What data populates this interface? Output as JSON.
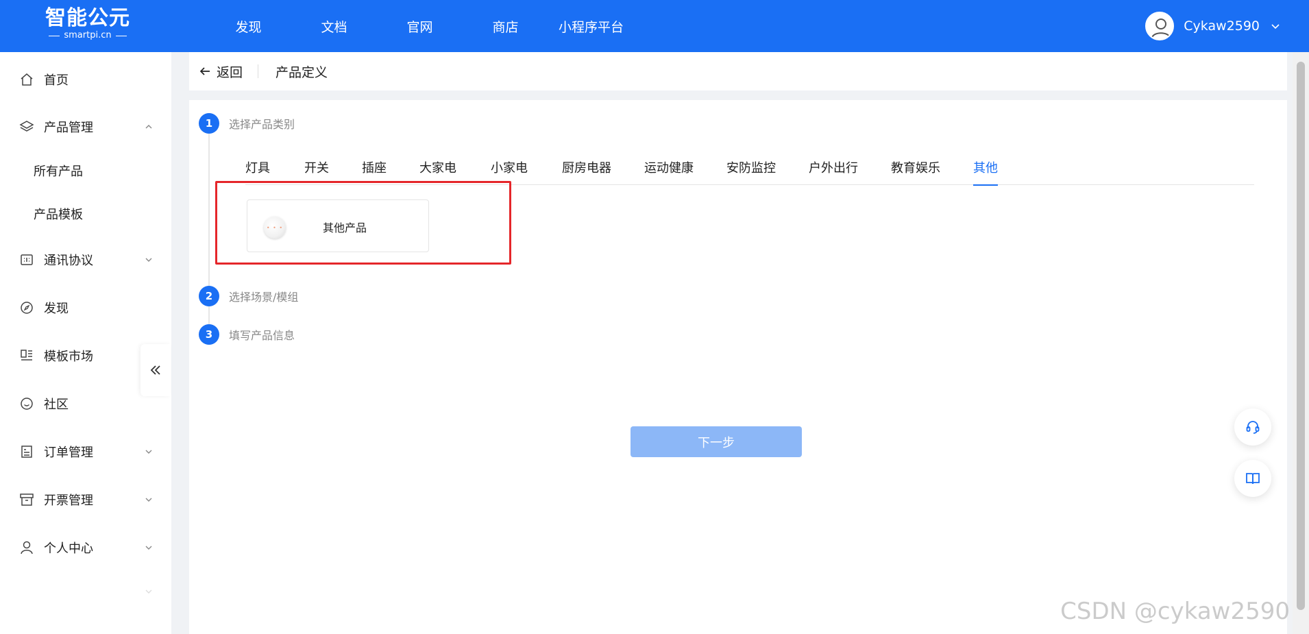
{
  "brand": {
    "name": "智能公元",
    "domain": "smartpi.cn"
  },
  "topnav": {
    "items": [
      "发现",
      "文档",
      "官网",
      "商店",
      "小程序平台"
    ]
  },
  "user": {
    "name": "Cykaw2590"
  },
  "sidebar": {
    "items": [
      {
        "label": "首页",
        "icon": "home-icon"
      },
      {
        "label": "产品管理",
        "icon": "layers-icon",
        "expanded": true,
        "children": [
          "所有产品",
          "产品模板"
        ]
      },
      {
        "label": "通讯协议",
        "icon": "protocol-icon"
      },
      {
        "label": "发现",
        "icon": "compass-icon"
      },
      {
        "label": "模板市场",
        "icon": "template-icon"
      },
      {
        "label": "社区",
        "icon": "community-icon"
      },
      {
        "label": "订单管理",
        "icon": "order-icon"
      },
      {
        "label": "开票管理",
        "icon": "invoice-icon"
      },
      {
        "label": "个人中心",
        "icon": "user-icon"
      }
    ]
  },
  "header": {
    "back_label": "返回",
    "title": "产品定义"
  },
  "steps": [
    {
      "number": "1",
      "label": "选择产品类别"
    },
    {
      "number": "2",
      "label": "选择场景/模组"
    },
    {
      "number": "3",
      "label": "填写产品信息"
    }
  ],
  "category_tabs": {
    "items": [
      "灯具",
      "开关",
      "插座",
      "大家电",
      "小家电",
      "厨房电器",
      "运动健康",
      "安防监控",
      "户外出行",
      "教育娱乐",
      "其他"
    ],
    "active": "其他"
  },
  "products": [
    {
      "name": "其他产品",
      "thumb_text": "• • •"
    }
  ],
  "next_button_label": "下一步",
  "watermark": "CSDN @cykaw2590",
  "colors": {
    "primary": "#1a6ff4",
    "highlight": "#e5262a",
    "disabled_button": "#8cb7f7"
  }
}
